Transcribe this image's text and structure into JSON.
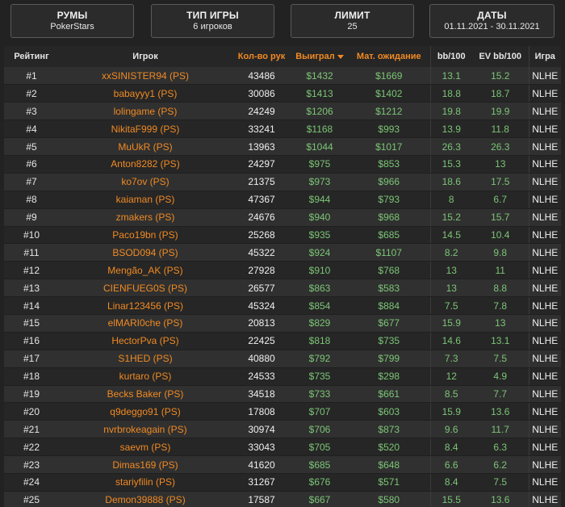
{
  "filters": [
    {
      "title": "РУМЫ",
      "value": "PokerStars"
    },
    {
      "title": "ТИП ИГРЫ",
      "value": "6 игроков"
    },
    {
      "title": "ЛИМИТ",
      "value": "25"
    },
    {
      "title": "ДАТЫ",
      "value": "01.11.2021 - 30.11.2021"
    }
  ],
  "table": {
    "headers": {
      "rank": "Рейтинг",
      "player": "Игрок",
      "hands": "Кол-во рук",
      "won": "Выиграл",
      "ev": "Мат. ожидание",
      "bb100": "bb/100",
      "evbb100": "EV bb/100",
      "game": "Игра"
    },
    "rows": [
      {
        "rank": "#1",
        "player": "xxSINISTER94 (PS)",
        "hands": "43486",
        "won": "$1432",
        "ev": "$1669",
        "bb": "13.1",
        "evbb": "15.2",
        "game": "NLHE"
      },
      {
        "rank": "#2",
        "player": "babayyy1 (PS)",
        "hands": "30086",
        "won": "$1413",
        "ev": "$1402",
        "bb": "18.8",
        "evbb": "18.7",
        "game": "NLHE"
      },
      {
        "rank": "#3",
        "player": "lolingame (PS)",
        "hands": "24249",
        "won": "$1206",
        "ev": "$1212",
        "bb": "19.8",
        "evbb": "19.9",
        "game": "NLHE"
      },
      {
        "rank": "#4",
        "player": "NikitaF999 (PS)",
        "hands": "33241",
        "won": "$1168",
        "ev": "$993",
        "bb": "13.9",
        "evbb": "11.8",
        "game": "NLHE"
      },
      {
        "rank": "#5",
        "player": "MuUkR (PS)",
        "hands": "13963",
        "won": "$1044",
        "ev": "$1017",
        "bb": "26.3",
        "evbb": "26.3",
        "game": "NLHE"
      },
      {
        "rank": "#6",
        "player": "Anton8282 (PS)",
        "hands": "24297",
        "won": "$975",
        "ev": "$853",
        "bb": "15.3",
        "evbb": "13",
        "game": "NLHE"
      },
      {
        "rank": "#7",
        "player": "ko7ov (PS)",
        "hands": "21375",
        "won": "$973",
        "ev": "$966",
        "bb": "18.6",
        "evbb": "17.5",
        "game": "NLHE"
      },
      {
        "rank": "#8",
        "player": "kaiaman (PS)",
        "hands": "47367",
        "won": "$944",
        "ev": "$793",
        "bb": "8",
        "evbb": "6.7",
        "game": "NLHE"
      },
      {
        "rank": "#9",
        "player": "zmakers (PS)",
        "hands": "24676",
        "won": "$940",
        "ev": "$968",
        "bb": "15.2",
        "evbb": "15.7",
        "game": "NLHE"
      },
      {
        "rank": "#10",
        "player": "Paco19bn (PS)",
        "hands": "25268",
        "won": "$935",
        "ev": "$685",
        "bb": "14.5",
        "evbb": "10.4",
        "game": "NLHE"
      },
      {
        "rank": "#11",
        "player": "BSOD094 (PS)",
        "hands": "45322",
        "won": "$924",
        "ev": "$1107",
        "bb": "8.2",
        "evbb": "9.8",
        "game": "NLHE"
      },
      {
        "rank": "#12",
        "player": "Mengão_AK (PS)",
        "hands": "27928",
        "won": "$910",
        "ev": "$768",
        "bb": "13",
        "evbb": "11",
        "game": "NLHE"
      },
      {
        "rank": "#13",
        "player": "CIENFUEG0S (PS)",
        "hands": "26577",
        "won": "$863",
        "ev": "$583",
        "bb": "13",
        "evbb": "8.8",
        "game": "NLHE"
      },
      {
        "rank": "#14",
        "player": "Linar123456 (PS)",
        "hands": "45324",
        "won": "$854",
        "ev": "$884",
        "bb": "7.5",
        "evbb": "7.8",
        "game": "NLHE"
      },
      {
        "rank": "#15",
        "player": "elMARI0che (PS)",
        "hands": "20813",
        "won": "$829",
        "ev": "$677",
        "bb": "15.9",
        "evbb": "13",
        "game": "NLHE"
      },
      {
        "rank": "#16",
        "player": "HectorPva (PS)",
        "hands": "22425",
        "won": "$818",
        "ev": "$735",
        "bb": "14.6",
        "evbb": "13.1",
        "game": "NLHE"
      },
      {
        "rank": "#17",
        "player": "S1HED (PS)",
        "hands": "40880",
        "won": "$792",
        "ev": "$799",
        "bb": "7.3",
        "evbb": "7.5",
        "game": "NLHE"
      },
      {
        "rank": "#18",
        "player": "kurtaro (PS)",
        "hands": "24533",
        "won": "$735",
        "ev": "$298",
        "bb": "12",
        "evbb": "4.9",
        "game": "NLHE"
      },
      {
        "rank": "#19",
        "player": "Becks Baker (PS)",
        "hands": "34518",
        "won": "$733",
        "ev": "$661",
        "bb": "8.5",
        "evbb": "7.7",
        "game": "NLHE"
      },
      {
        "rank": "#20",
        "player": "q9deggo91 (PS)",
        "hands": "17808",
        "won": "$707",
        "ev": "$603",
        "bb": "15.9",
        "evbb": "13.6",
        "game": "NLHE"
      },
      {
        "rank": "#21",
        "player": "nvrbrokeagain (PS)",
        "hands": "30974",
        "won": "$706",
        "ev": "$873",
        "bb": "9.6",
        "evbb": "11.7",
        "game": "NLHE"
      },
      {
        "rank": "#22",
        "player": "saevm (PS)",
        "hands": "33043",
        "won": "$705",
        "ev": "$520",
        "bb": "8.4",
        "evbb": "6.3",
        "game": "NLHE"
      },
      {
        "rank": "#23",
        "player": "Dimas169 (PS)",
        "hands": "41620",
        "won": "$685",
        "ev": "$648",
        "bb": "6.6",
        "evbb": "6.2",
        "game": "NLHE"
      },
      {
        "rank": "#24",
        "player": "stariyfilin (PS)",
        "hands": "31267",
        "won": "$676",
        "ev": "$571",
        "bb": "8.4",
        "evbb": "7.5",
        "game": "NLHE"
      },
      {
        "rank": "#25",
        "player": "Demon39888 (PS)",
        "hands": "17587",
        "won": "$667",
        "ev": "$580",
        "bb": "15.5",
        "evbb": "13.6",
        "game": "NLHE"
      }
    ]
  },
  "colors": {
    "accent": "#f08a24",
    "positive": "#7cc576",
    "background": "#222222"
  },
  "icons": {
    "sort": "sort-desc-arrow-icon"
  }
}
